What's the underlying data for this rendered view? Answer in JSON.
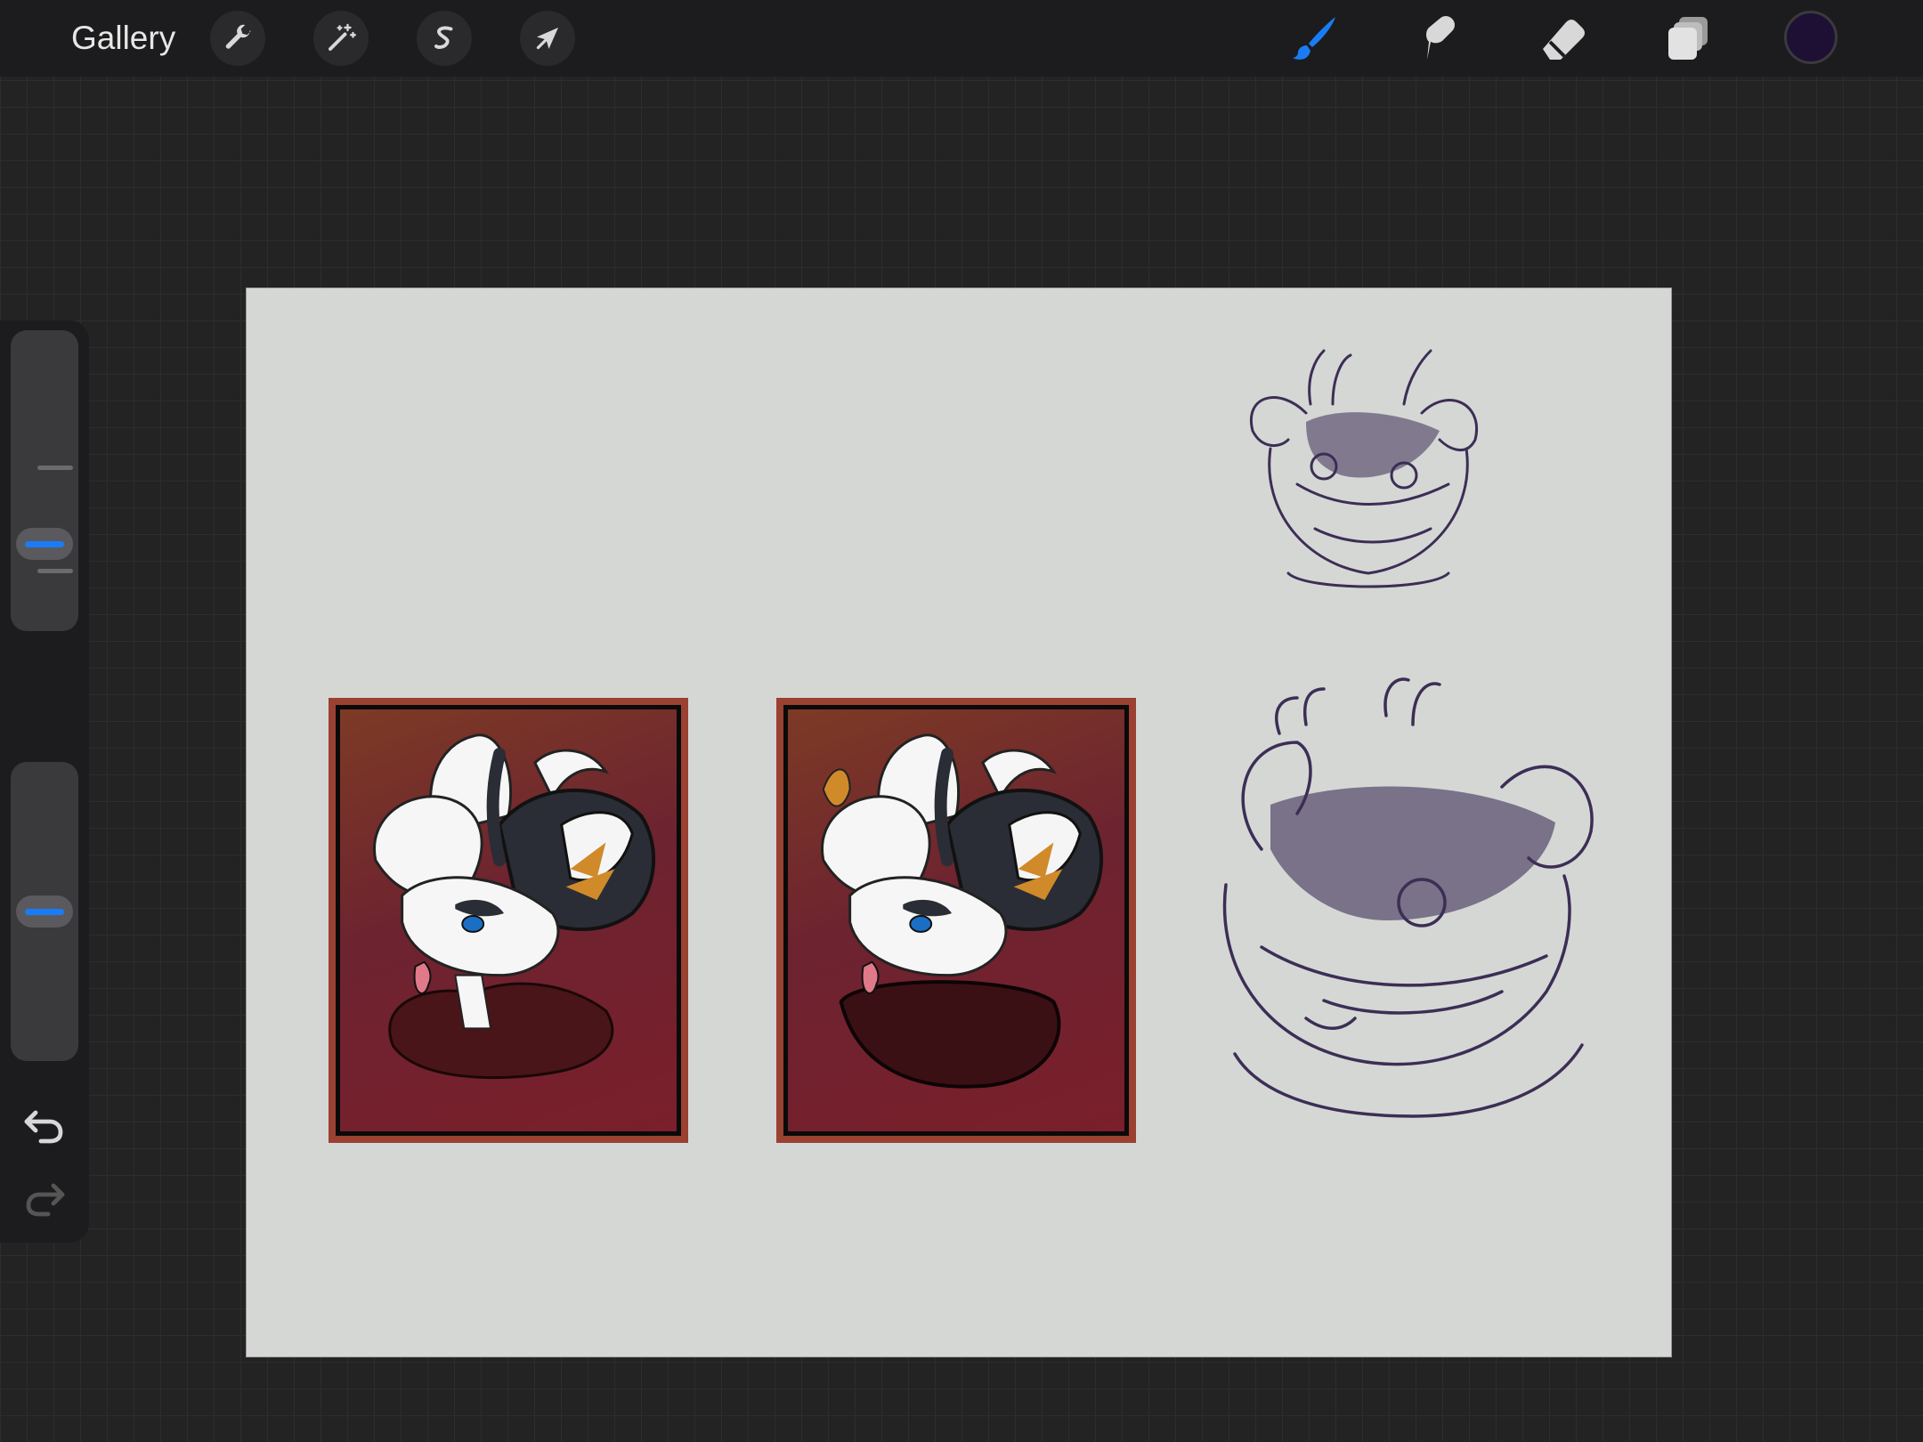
{
  "topbar": {
    "gallery_label": "Gallery",
    "action_icons": [
      "wrench-icon",
      "magic-wand-icon",
      "selection-icon",
      "transform-arrow-icon"
    ],
    "tools": [
      "brush-icon",
      "smudge-icon",
      "eraser-icon",
      "layers-icon"
    ],
    "active_tool": "brush",
    "current_color": "#1e1035"
  },
  "sidebar": {
    "brush_size_level": 0.7,
    "opacity_level": 0.5,
    "accent_color": "#1a7cf5"
  },
  "canvas": {
    "background_color": "#d5d7d5",
    "artworks": [
      "colored-portrait-1",
      "colored-portrait-2",
      "sketch-small",
      "sketch-large"
    ]
  }
}
